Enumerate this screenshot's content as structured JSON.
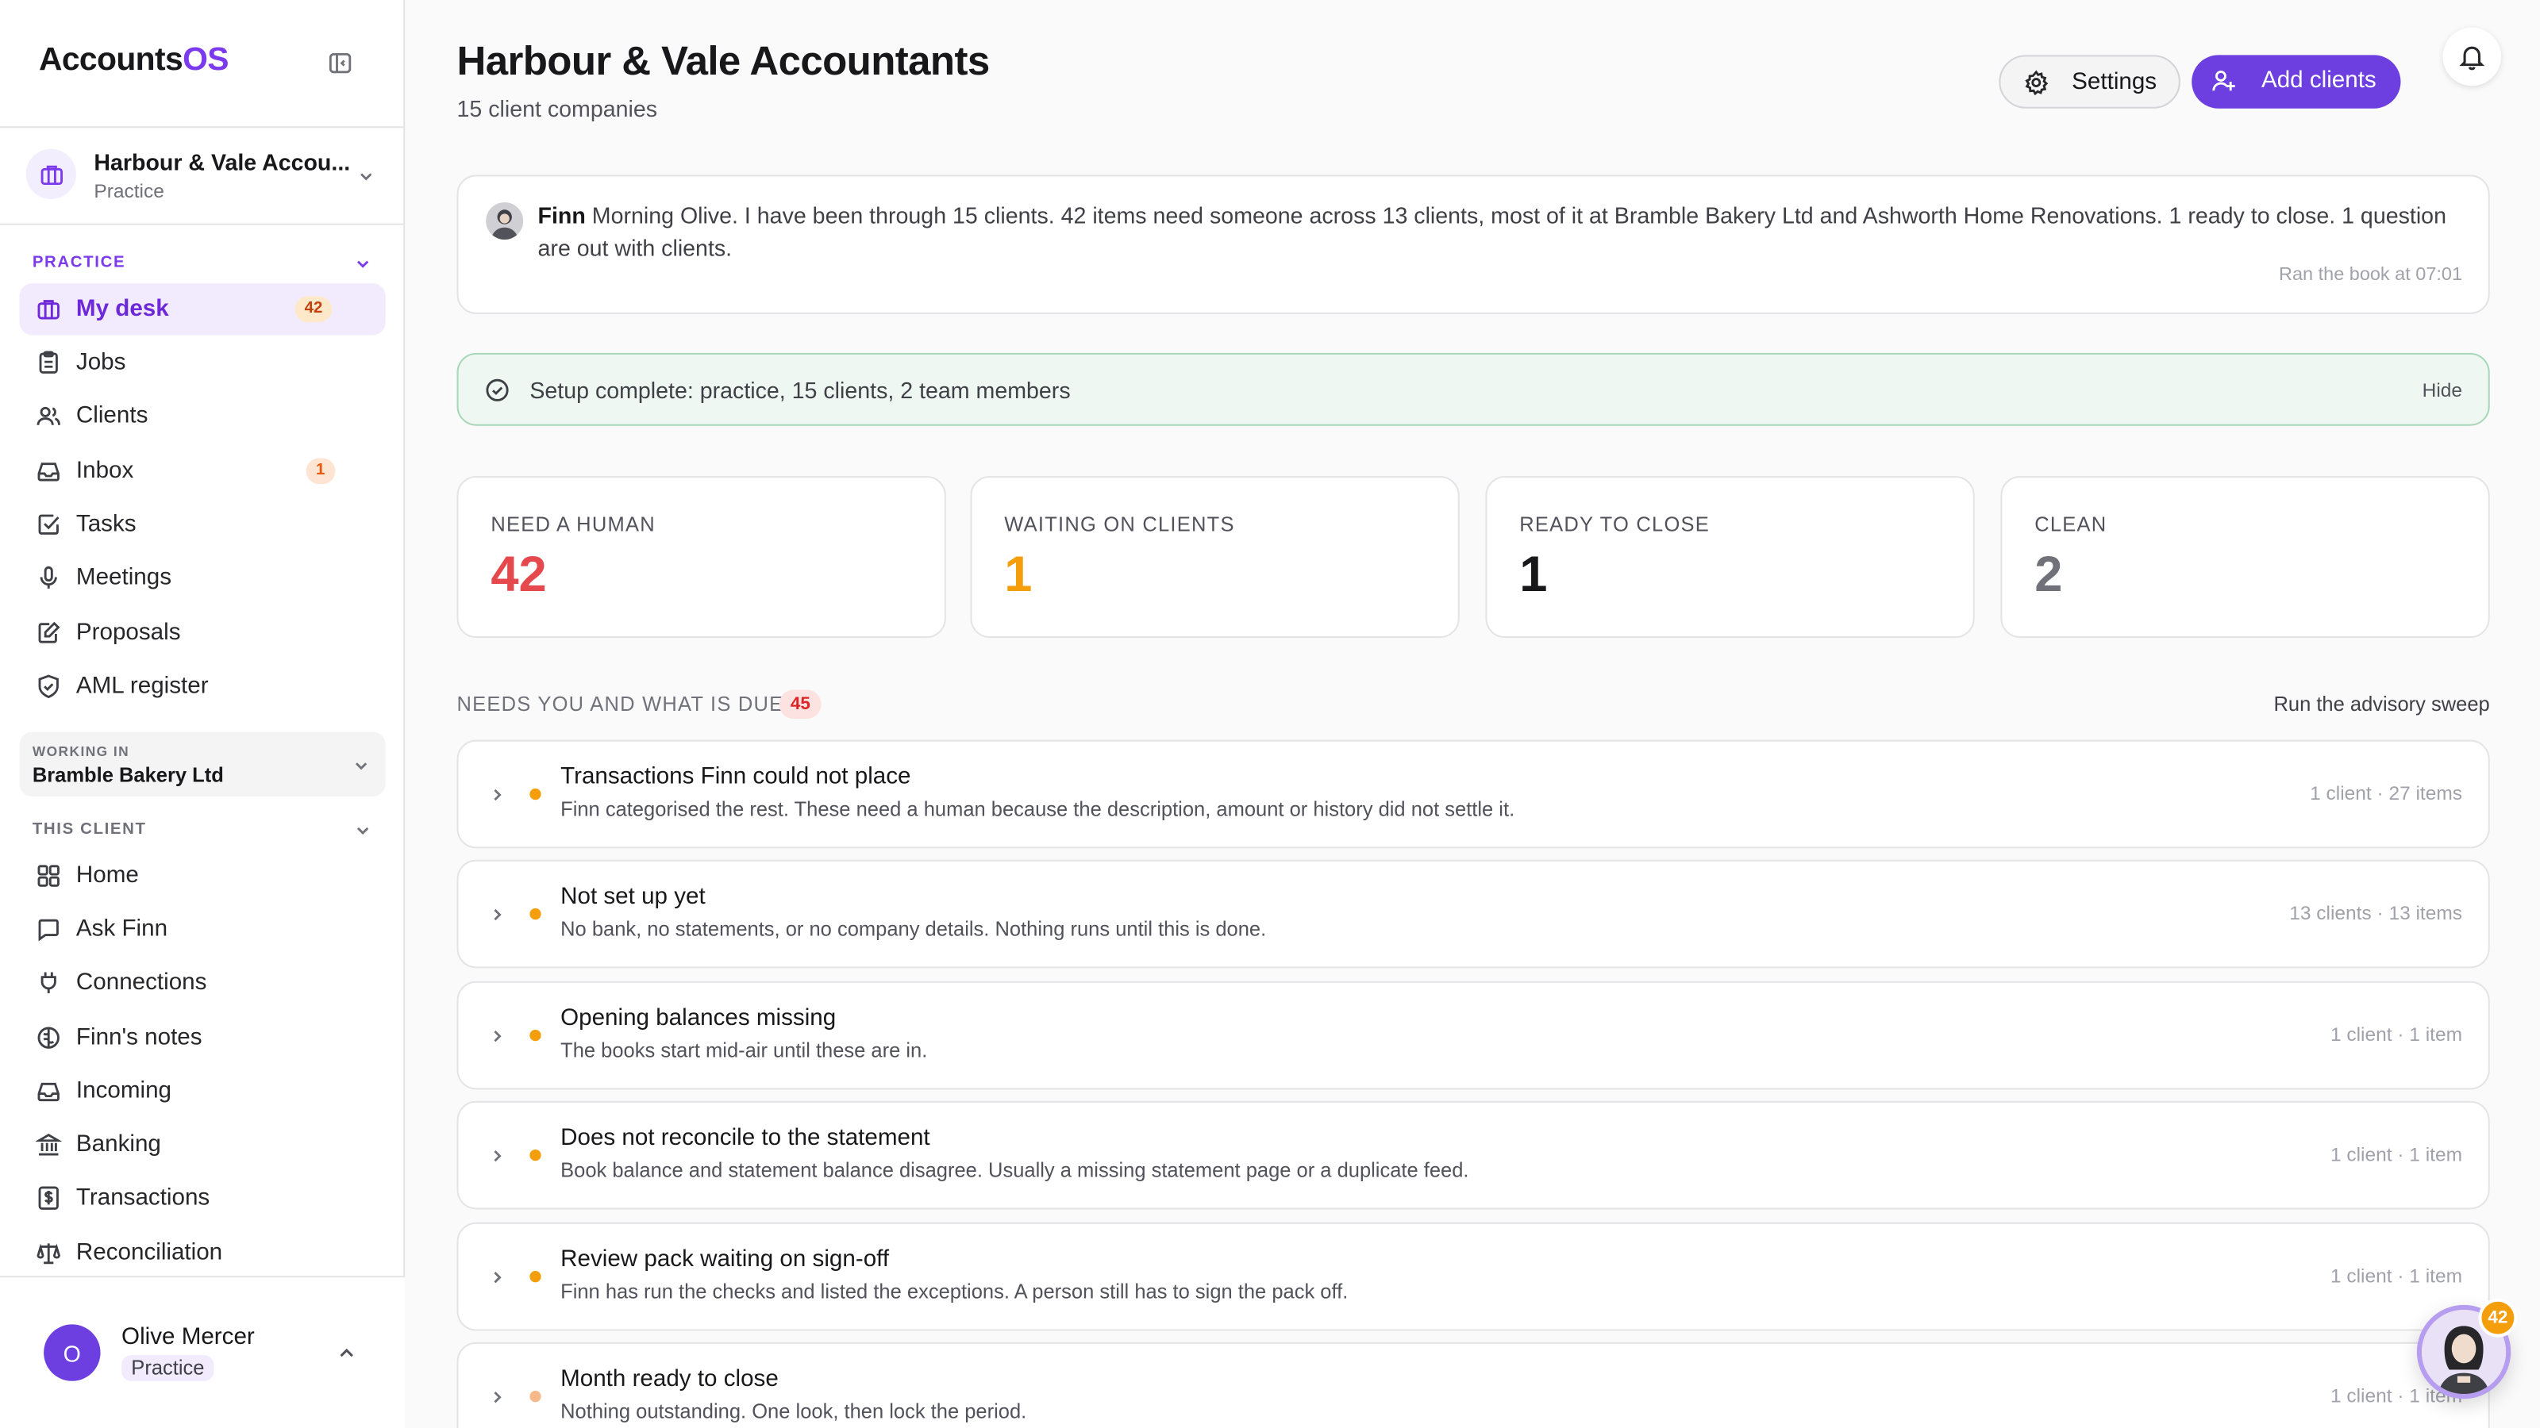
{
  "app": {
    "brand_main": "Accounts",
    "brand_accent": "OS"
  },
  "practice_switcher": {
    "name": "Harbour & Vale Accou...",
    "role": "Practice"
  },
  "sidebar": {
    "practice_section": "PRACTICE",
    "practice_items": [
      {
        "label": "My desk",
        "icon": "briefcase-icon",
        "badge": "42",
        "active": true
      },
      {
        "label": "Jobs",
        "icon": "clipboard-icon"
      },
      {
        "label": "Clients",
        "icon": "users-icon"
      },
      {
        "label": "Inbox",
        "icon": "inbox-icon",
        "badge": "1"
      },
      {
        "label": "Tasks",
        "icon": "checkbox-icon"
      },
      {
        "label": "Meetings",
        "icon": "microphone-icon"
      },
      {
        "label": "Proposals",
        "icon": "edit-document-icon"
      },
      {
        "label": "AML register",
        "icon": "shield-check-icon"
      }
    ],
    "working_in": {
      "label": "WORKING IN",
      "value": "Bramble Bakery Ltd"
    },
    "client_section": "THIS CLIENT",
    "client_items": [
      {
        "label": "Home",
        "icon": "grid-icon"
      },
      {
        "label": "Ask Finn",
        "icon": "chat-icon"
      },
      {
        "label": "Connections",
        "icon": "plug-icon"
      },
      {
        "label": "Finn's notes",
        "icon": "brain-icon"
      },
      {
        "label": "Incoming",
        "icon": "inbox-icon"
      },
      {
        "label": "Banking",
        "icon": "bank-icon"
      },
      {
        "label": "Transactions",
        "icon": "dollar-doc-icon"
      },
      {
        "label": "Reconciliation",
        "icon": "scale-icon"
      }
    ],
    "user": {
      "initial": "O",
      "name": "Olive Mercer",
      "role": "Practice"
    }
  },
  "header": {
    "title": "Harbour & Vale Accountants",
    "subtitle": "15 client companies",
    "settings_label": "Settings",
    "add_label": "Add clients"
  },
  "finn": {
    "name": "Finn",
    "message": "Morning Olive. I have been through 15 clients. 42 items need someone across 13 clients, most of it at Bramble Bakery Ltd and Ashworth Home Renovations. 1 ready to close. 1 question are out with clients.",
    "time": "Ran the book at 07:01"
  },
  "setup": {
    "text": "Setup complete: practice, 15 clients, 2 team members",
    "hide": "Hide"
  },
  "stats": [
    {
      "label": "NEED A HUMAN",
      "value": "42",
      "color": "#e5484d"
    },
    {
      "label": "WAITING ON CLIENTS",
      "value": "1",
      "color": "#f59e0b"
    },
    {
      "label": "READY TO CLOSE",
      "value": "1",
      "color": "#18181b"
    },
    {
      "label": "CLEAN",
      "value": "2",
      "color": "#71717a"
    }
  ],
  "queue": {
    "heading": "NEEDS YOU AND WHAT IS DUE",
    "count": "45",
    "sweep": "Run the advisory sweep",
    "rows": [
      {
        "title": "Transactions Finn could not place",
        "desc": "Finn categorised the rest. These need a human because the description, amount or history did not settle it.",
        "meta": "1 client · 27 items"
      },
      {
        "title": "Not set up yet",
        "desc": "No bank, no statements, or no company details. Nothing runs until this is done.",
        "meta": "13 clients · 13 items"
      },
      {
        "title": "Opening balances missing",
        "desc": "The books start mid-air until these are in.",
        "meta": "1 client · 1 item"
      },
      {
        "title": "Does not reconcile to the statement",
        "desc": "Book balance and statement balance disagree. Usually a missing statement page or a duplicate feed.",
        "meta": "1 client · 1 item"
      },
      {
        "title": "Review pack waiting on sign-off",
        "desc": "Finn has run the checks and listed the exceptions. A person still has to sign the pack off.",
        "meta": "1 client · 1 item"
      },
      {
        "title": "Month ready to close",
        "desc": "Nothing outstanding. One look, then lock the period.",
        "meta": "1 client · 1 item"
      }
    ]
  },
  "assistant_badge": "42",
  "colors": {
    "accent": "#6d3fe0",
    "warning": "#f59e0b",
    "danger": "#e5484d",
    "success_bg": "#eef7f1"
  }
}
